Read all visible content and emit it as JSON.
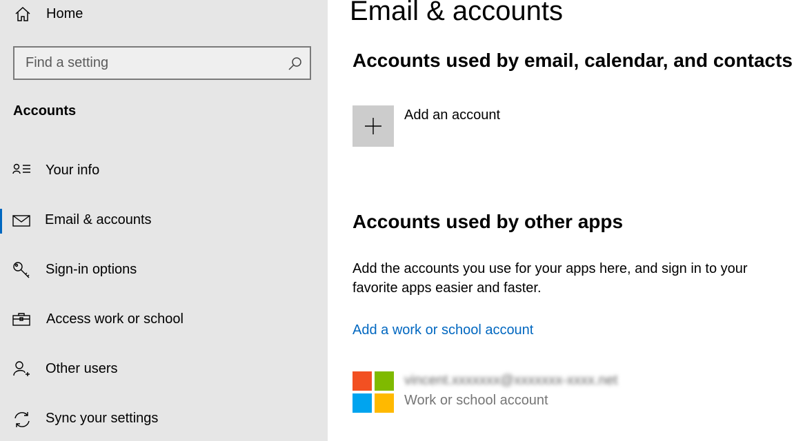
{
  "sidebar": {
    "home_label": "Home",
    "search_placeholder": "Find a setting",
    "section_title": "Accounts",
    "items": [
      {
        "label": "Your info",
        "icon": "person-list-icon"
      },
      {
        "label": "Email & accounts",
        "icon": "mail-icon",
        "active": true
      },
      {
        "label": "Sign-in options",
        "icon": "key-icon"
      },
      {
        "label": "Access work or school",
        "icon": "briefcase-icon"
      },
      {
        "label": "Other users",
        "icon": "add-person-icon"
      },
      {
        "label": "Sync your settings",
        "icon": "sync-icon"
      }
    ]
  },
  "main": {
    "title": "Email & accounts",
    "section1_heading": "Accounts used by email, calendar, and contacts",
    "add_account_label": "Add an account",
    "section2_heading": "Accounts used by other apps",
    "section2_description": "Add the accounts you use for your apps here, and sign in to your favorite apps easier and faster.",
    "add_work_link": "Add a work or school account",
    "account": {
      "email": "vincent.xxxxxxx@xxxxxxx-xxxx.net",
      "type": "Work or school account"
    }
  },
  "colors": {
    "sidebar_bg": "#e6e6e6",
    "accent": "#0067c0",
    "ms_red": "#f25022",
    "ms_green": "#7fba00",
    "ms_blue": "#00a4ef",
    "ms_yellow": "#ffb900"
  }
}
